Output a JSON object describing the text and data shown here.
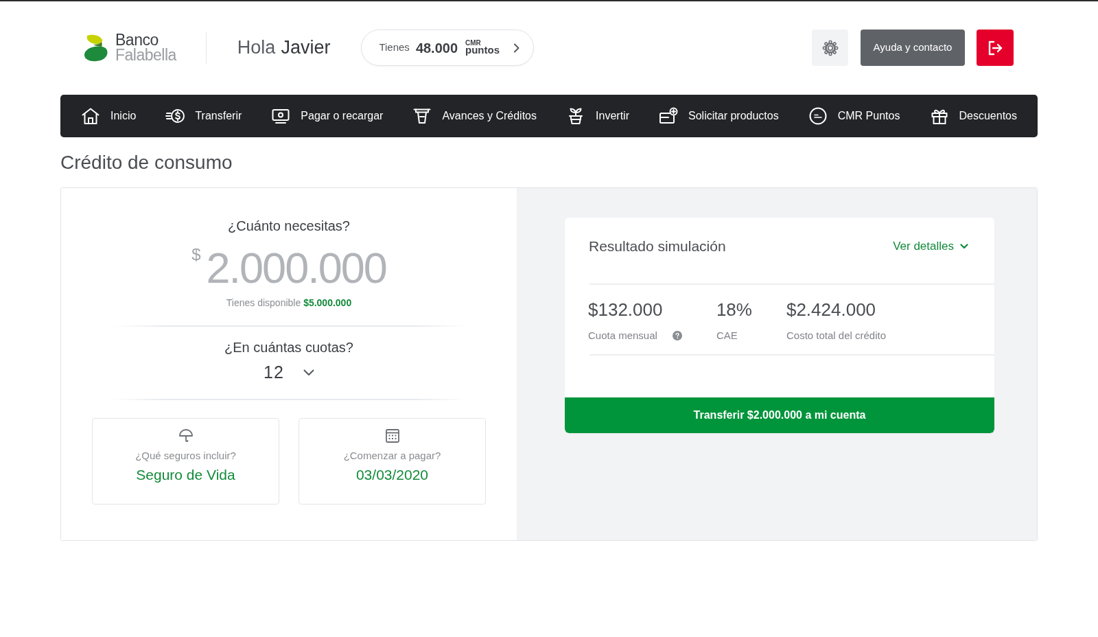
{
  "header": {
    "logo": {
      "line_1": "Banco",
      "line_2": "Falabella"
    },
    "greeting": {
      "prefix": "Hola",
      "name": "Javier"
    },
    "points": {
      "label": "Tienes",
      "value": "48.000",
      "brand_top": "CMR",
      "brand_bottom": "puntos"
    },
    "help_button": "Ayuda y contacto"
  },
  "nav": [
    {
      "kind": "home",
      "label": "Inicio"
    },
    {
      "kind": "transfer",
      "label": "Transferir"
    },
    {
      "kind": "pay",
      "label": "Pagar o recargar"
    },
    {
      "kind": "advance",
      "label": "Avances y Créditos"
    },
    {
      "kind": "invest",
      "label": "Invertir"
    },
    {
      "kind": "request",
      "label": "Solicitar productos"
    },
    {
      "kind": "points",
      "label": "CMR Puntos"
    },
    {
      "kind": "gift",
      "label": "Descuentos"
    }
  ],
  "page_title": "Crédito de consumo",
  "simulator": {
    "amount_question": "¿Cuánto necesitas?",
    "currency": "$",
    "amount": "2.000.000",
    "available_label": "Tienes disponible",
    "available_amount": "$5.000.000",
    "installments_question": "¿En cuántas cuotas?",
    "installments": "12",
    "options": [
      {
        "kind": "insurance",
        "label": "¿Qué seguros incluir?",
        "value": "Seguro de Vida"
      },
      {
        "kind": "date",
        "label": "¿Comenzar a pagar?",
        "value": "03/03/2020"
      }
    ]
  },
  "result": {
    "title": "Resultado simulación",
    "details_link": "Ver detalles",
    "figures": [
      {
        "value": "$132.000",
        "label": "Cuota mensual",
        "help": true
      },
      {
        "value": "18%",
        "label": "CAE",
        "help": false
      },
      {
        "value": "$2.424.000",
        "label": "Costo total del crédito",
        "help": false
      }
    ],
    "button": "Transferir $2.000.000 a mi cuenta"
  }
}
